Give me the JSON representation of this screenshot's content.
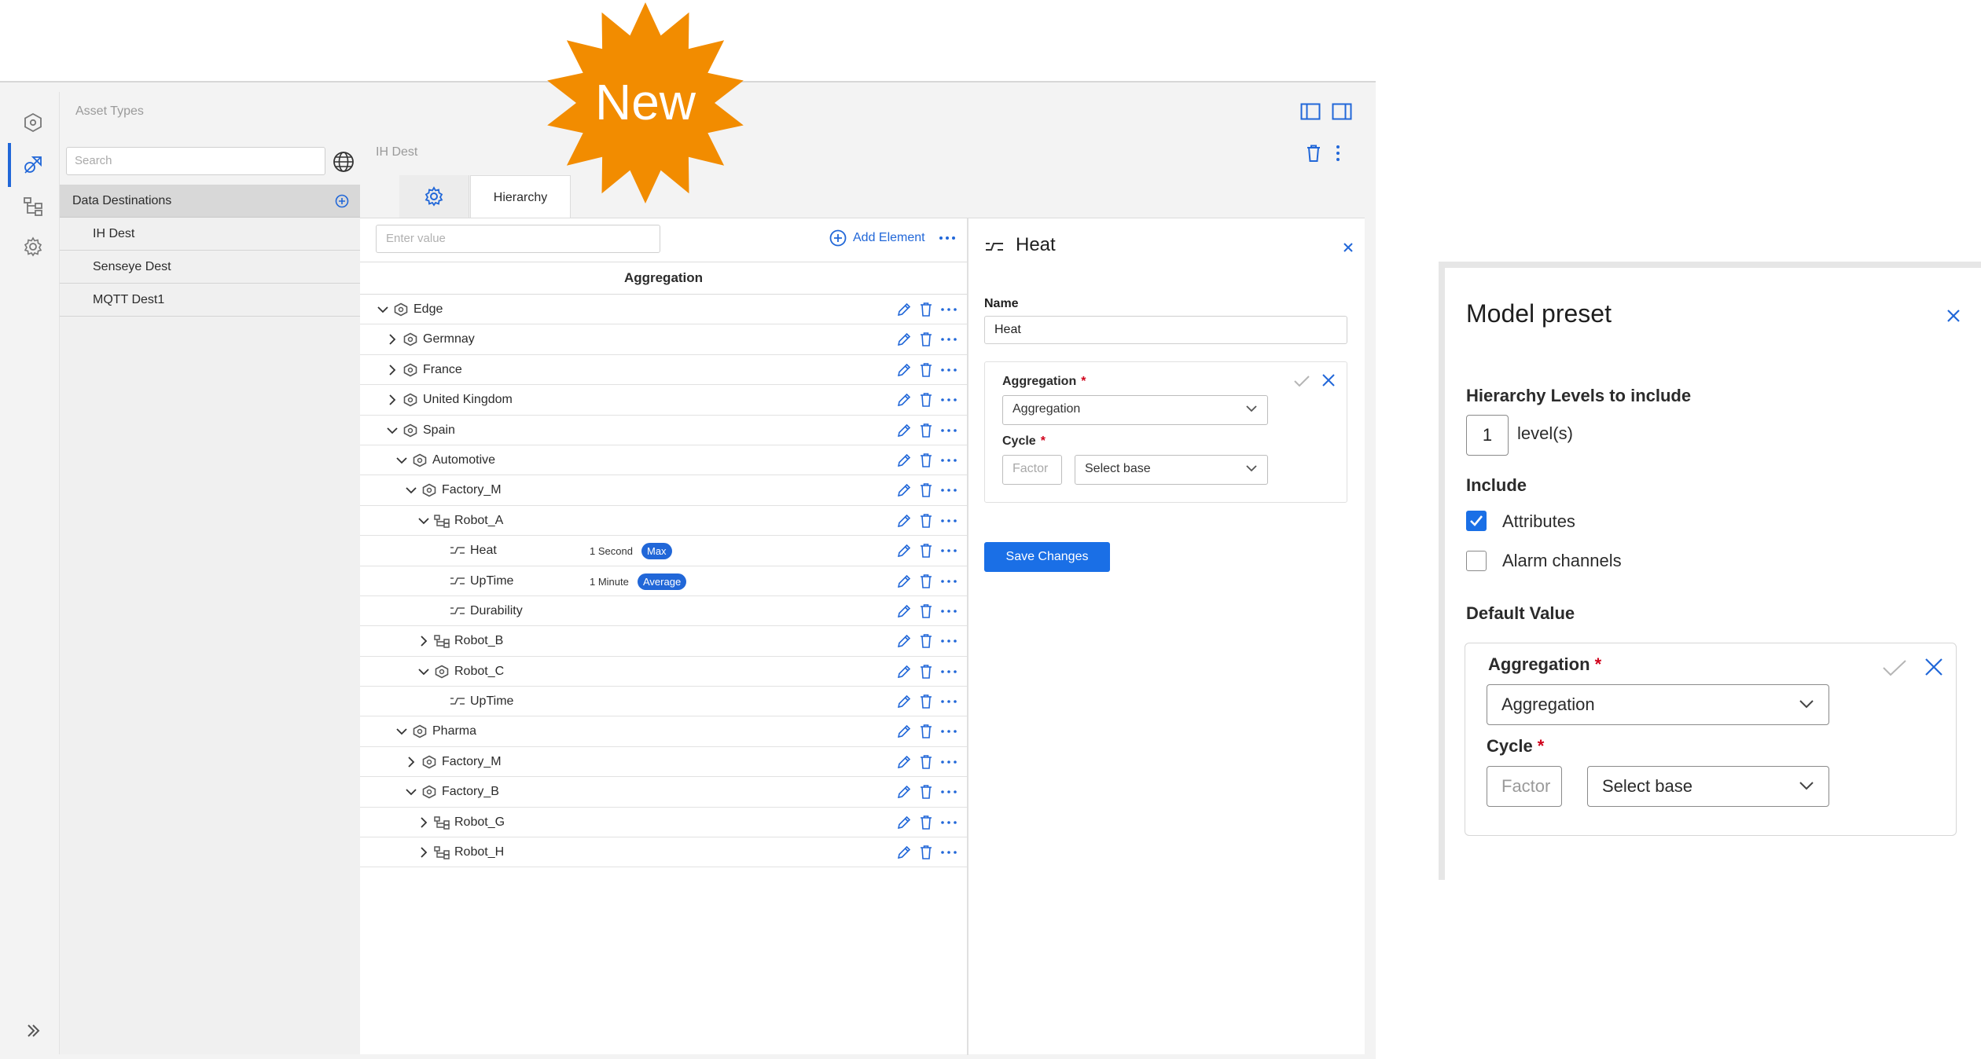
{
  "badge": {
    "label": "New",
    "color": "#f28c00"
  },
  "nav": {
    "title": "Asset Types",
    "rail_icons": [
      "hexagon-icon",
      "shape-icon",
      "tree-icon",
      "settings-icon",
      "chevron-right-icon"
    ],
    "active_icon": "shape-icon"
  },
  "left_panel": {
    "search_placeholder": "Search",
    "section_title": "Data Destinations",
    "items": [
      "IH Dest",
      "Senseye Dest",
      "MQTT Dest1"
    ]
  },
  "center": {
    "breadcrumb": "IH Dest",
    "tabs": {
      "active": "Hierarchy",
      "hierarchy_label": "Hierarchy"
    },
    "filter_placeholder": "Enter value",
    "add_element_label": "Add Element",
    "column_header": "Aggregation",
    "tree": [
      {
        "label": "Edge",
        "level": 0,
        "icon": "asset",
        "state": "expanded"
      },
      {
        "label": "Germnay",
        "level": 1,
        "icon": "asset",
        "state": "collapsed"
      },
      {
        "label": "France",
        "level": 1,
        "icon": "asset",
        "state": "collapsed"
      },
      {
        "label": "United Kingdom",
        "level": 1,
        "icon": "asset",
        "state": "collapsed"
      },
      {
        "label": "Spain",
        "level": 1,
        "icon": "asset",
        "state": "expanded"
      },
      {
        "label": "Automotive",
        "level": 2,
        "icon": "asset",
        "state": "expanded"
      },
      {
        "label": "Factory_M",
        "level": 3,
        "icon": "asset",
        "state": "expanded"
      },
      {
        "label": "Robot_A",
        "level": 4,
        "icon": "type",
        "state": "expanded"
      },
      {
        "label": "Heat",
        "level": 5,
        "icon": "variable",
        "state": "leaf",
        "cycle": "1 Second",
        "aggregation": "Max"
      },
      {
        "label": "UpTime",
        "level": 5,
        "icon": "variable",
        "state": "leaf",
        "cycle": "1 Minute",
        "aggregation": "Average"
      },
      {
        "label": "Durability",
        "level": 5,
        "icon": "variable",
        "state": "leaf"
      },
      {
        "label": "Robot_B",
        "level": 4,
        "icon": "type",
        "state": "collapsed"
      },
      {
        "label": "Robot_C",
        "level": 4,
        "icon": "asset",
        "state": "expanded"
      },
      {
        "label": "UpTime",
        "level": 5,
        "icon": "variable",
        "state": "leaf"
      },
      {
        "label": "Pharma",
        "level": 2,
        "icon": "asset",
        "state": "expanded"
      },
      {
        "label": "Factory_M",
        "level": 3,
        "icon": "asset",
        "state": "collapsed"
      },
      {
        "label": "Factory_B",
        "level": 3,
        "icon": "asset",
        "state": "expanded"
      },
      {
        "label": "Robot_G",
        "level": 4,
        "icon": "type",
        "state": "collapsed"
      },
      {
        "label": "Robot_H",
        "level": 4,
        "icon": "type",
        "state": "collapsed"
      }
    ]
  },
  "detail": {
    "title": "Heat",
    "name_label": "Name",
    "name_value": "Heat",
    "aggregation_label": "Aggregation",
    "aggregation_value": "Aggregation",
    "cycle_label": "Cycle",
    "factor_placeholder": "Factor",
    "base_value": "Select base",
    "save_label": "Save Changes"
  },
  "preset": {
    "title": "Model preset",
    "levels_label": "Hierarchy Levels to include",
    "levels_value": "1",
    "levels_unit": "level(s)",
    "include_label": "Include",
    "options": [
      {
        "label": "Attributes",
        "checked": true
      },
      {
        "label": "Alarm channels",
        "checked": false
      }
    ],
    "default_label": "Default Value",
    "aggregation_label": "Aggregation",
    "aggregation_value": "Aggregation",
    "cycle_label": "Cycle",
    "factor_placeholder": "Factor",
    "base_value": "Select base"
  },
  "colors": {
    "accent": "#2167d8",
    "required": "#d0021b",
    "badge": "#f28c00"
  }
}
